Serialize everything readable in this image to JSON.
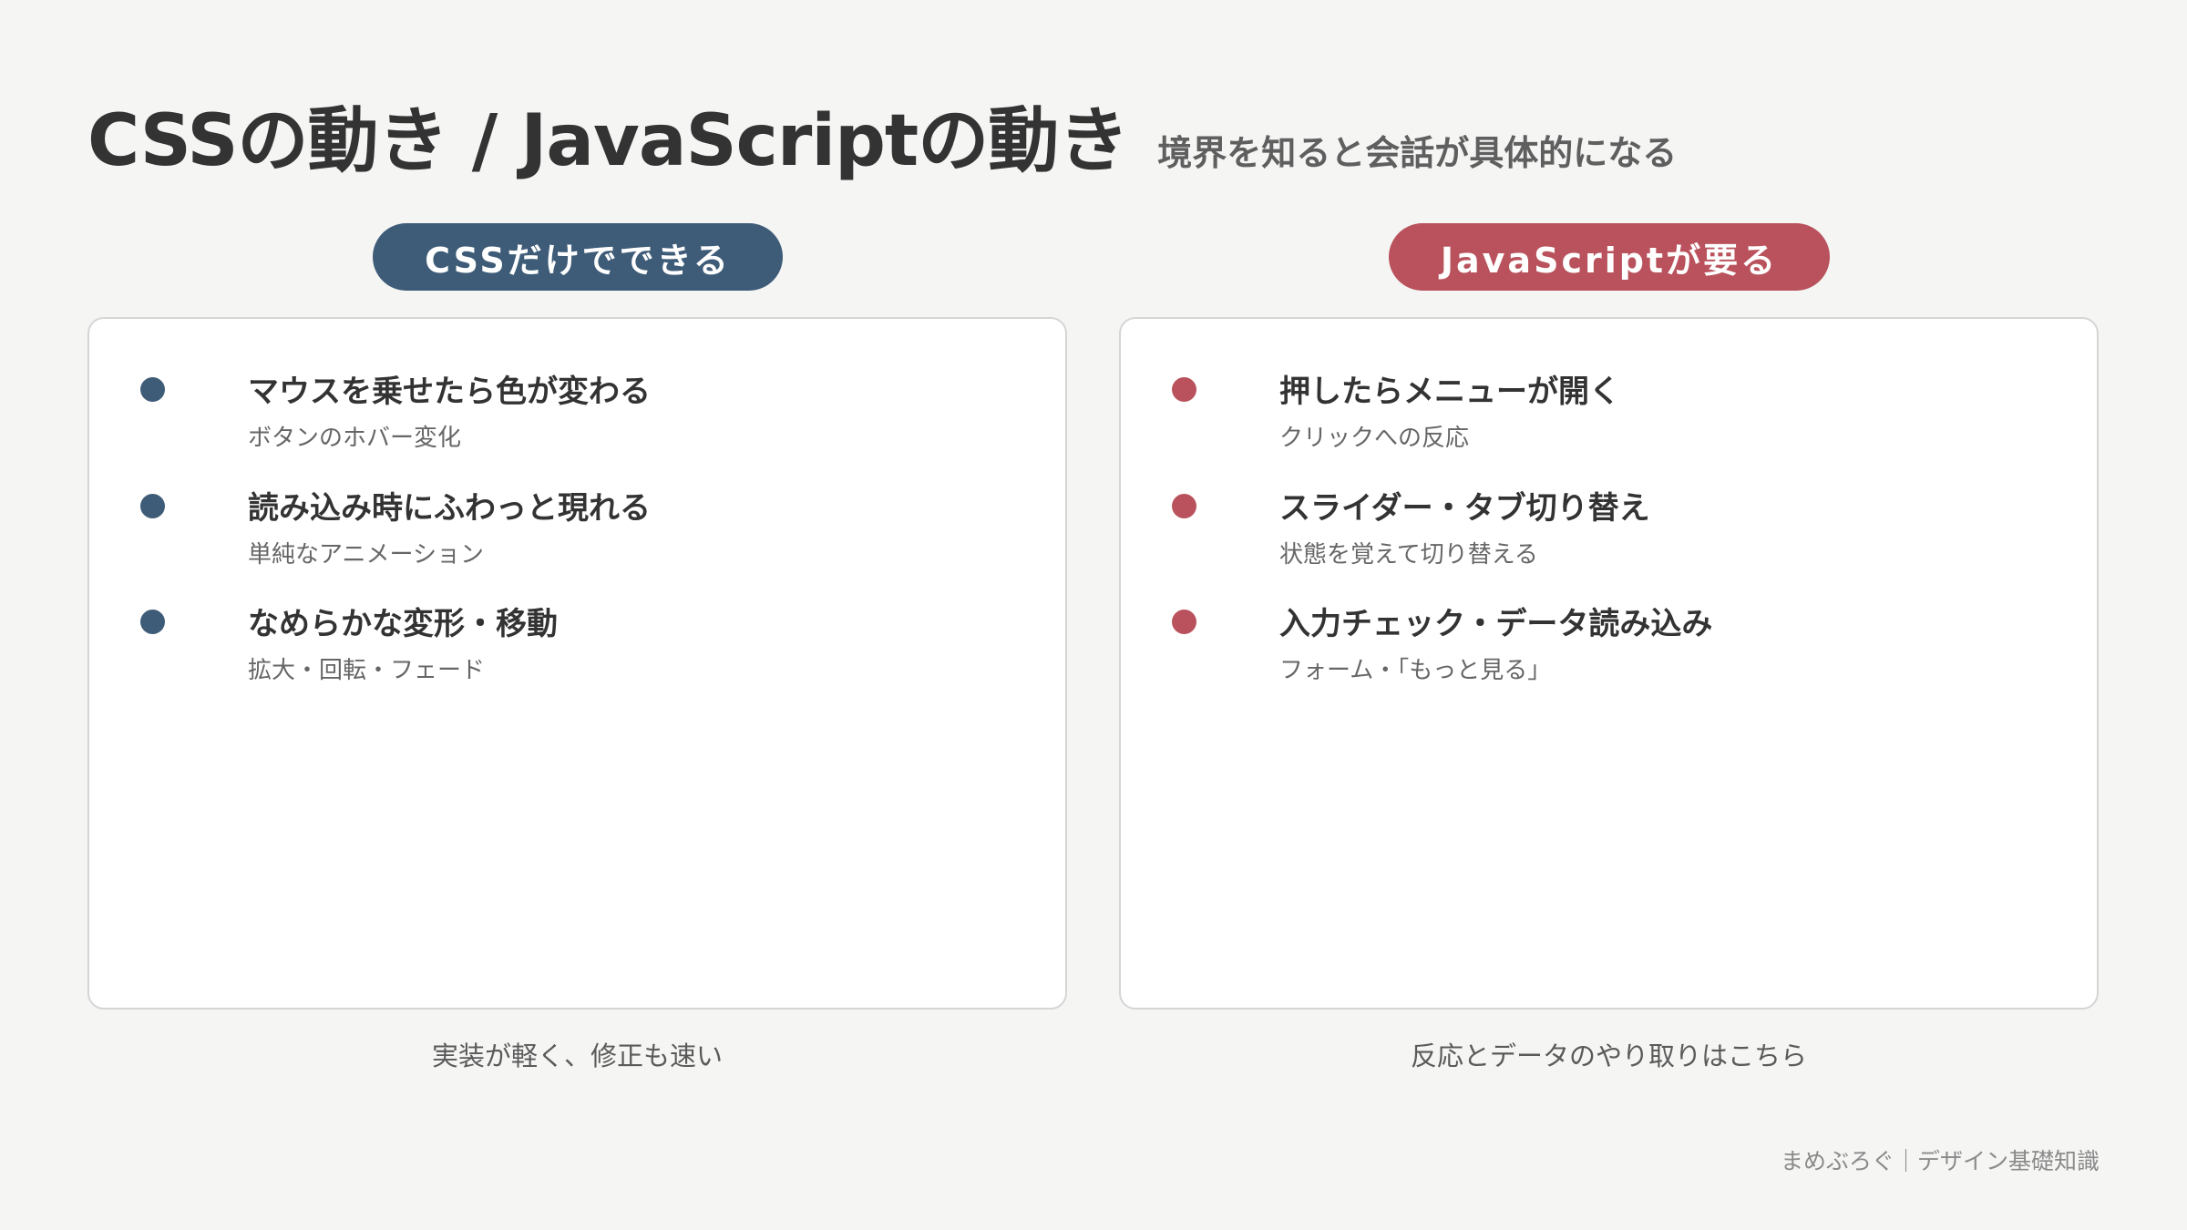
{
  "header": {
    "title": "CSSの動き / JavaScriptの動き",
    "subtitle": "境界を知ると会話が具体的になる"
  },
  "colors": {
    "css_accent": "#3e5c78",
    "js_accent": "#b9525c"
  },
  "css_column": {
    "label": "CSSだけでできる",
    "items": [
      {
        "title": "マウスを乗せたら色が変わる",
        "desc": "ボタンのホバー変化"
      },
      {
        "title": "読み込み時にふわっと現れる",
        "desc": "単純なアニメーション"
      },
      {
        "title": "なめらかな変形・移動",
        "desc": "拡大・回転・フェード"
      }
    ],
    "caption": "実装が軽く、修正も速い"
  },
  "js_column": {
    "label": "JavaScriptが要る",
    "items": [
      {
        "title": "押したらメニューが開く",
        "desc": "クリックへの反応"
      },
      {
        "title": "スライダー・タブ切り替え",
        "desc": "状態を覚えて切り替える"
      },
      {
        "title": "入力チェック・データ読み込み",
        "desc": "フォーム・「もっと見る」"
      }
    ],
    "caption": "反応とデータのやり取りはこちら"
  },
  "footer": {
    "text": "まめぶろぐ｜デザイン基礎知識"
  }
}
